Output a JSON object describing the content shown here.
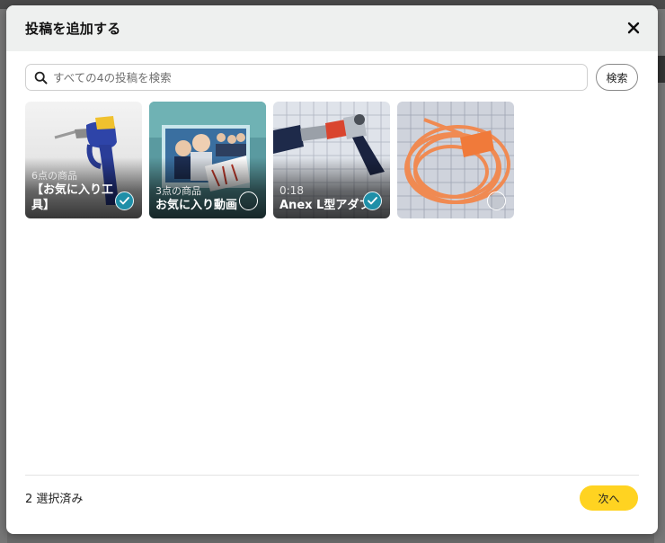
{
  "modal": {
    "title": "投稿を追加する",
    "close_icon": "close-icon"
  },
  "search": {
    "placeholder": "すべての4の投稿を検索",
    "value": "",
    "button_label": "検索",
    "icon": "search-icon"
  },
  "posts": [
    {
      "subtitle": "6点の商品",
      "title": "【お気に入り工具】",
      "selected": true,
      "thumbnail": "soldering-iron-photo"
    },
    {
      "subtitle": "3点の商品",
      "title": "お気に入り動画",
      "selected": false,
      "thumbnail": "tv-drama-cast-photo"
    },
    {
      "subtitle": "0:18",
      "title": "Anex L型アダプ",
      "selected": true,
      "thumbnail": "l-adapter-tool-photo"
    },
    {
      "subtitle": "",
      "title": "",
      "selected": false,
      "thumbnail": "orange-cable-photo"
    }
  ],
  "footer": {
    "selected_text": "2 選択済み",
    "next_label": "次へ"
  },
  "colors": {
    "accent_yellow": "#ffd321",
    "check_teal": "#1f8fa8",
    "header_bg": "#eef0ef"
  }
}
